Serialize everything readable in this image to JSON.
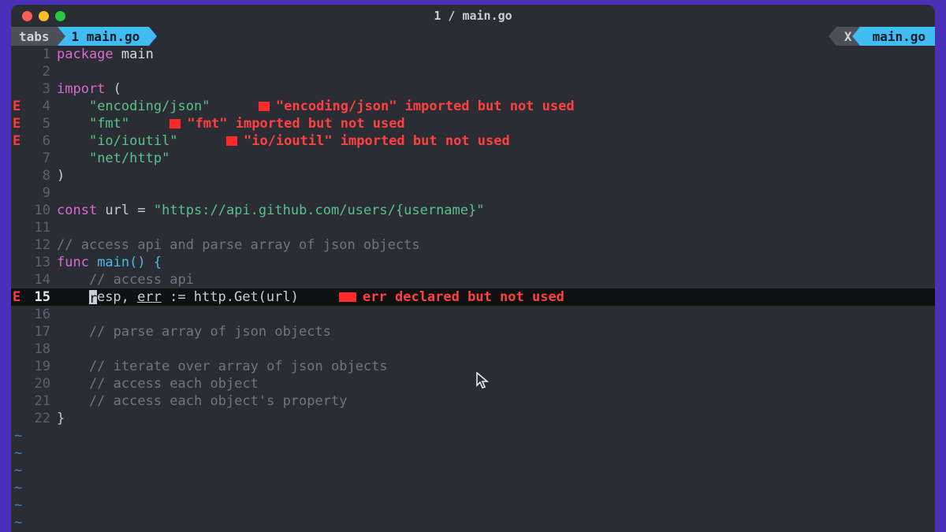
{
  "window": {
    "title": "1 / main.go"
  },
  "tabline": {
    "tabs_label": "tabs",
    "active_tab": "1 main.go",
    "close_x": "X",
    "right_name": "main.go"
  },
  "errors_gutter": {
    "E": "E"
  },
  "lines": {
    "n1": "1",
    "n2": "2",
    "n3": "3",
    "n4": "4",
    "n5": "5",
    "n6": "6",
    "n7": "7",
    "n8": "8",
    "n9": "9",
    "n10": "10",
    "n11": "11",
    "n12": "12",
    "n13": "13",
    "n14": "14",
    "n15": "15",
    "n16": "16",
    "n17": "17",
    "n18": "18",
    "n19": "19",
    "n20": "20",
    "n21": "21",
    "n22": "22"
  },
  "code": {
    "package": "package",
    "main": " main",
    "import": "import",
    "lparen": " (",
    "rparen": ")",
    "indent": "    ",
    "imp_json": "\"encoding/json\"",
    "imp_fmt": "\"fmt\"",
    "imp_ioutil": "\"io/ioutil\"",
    "imp_nethttp": "\"net/http\"",
    "const": "const",
    "url_decl": " url = ",
    "url_str": "\"https://api.github.com/users/{username}\"",
    "c_access_parse": "// access api and parse array of json objects",
    "func": "func",
    "main_sig": " main() {",
    "c_access_api": "    // access api",
    "resp_first": "r",
    "resp_rest": "esp, ",
    "err_word": "err",
    "assign": " := http.Get(url)",
    "c_parse": "    // parse array of json objects",
    "c_iterate": "    // iterate over array of json objects",
    "c_each_obj": "    // access each object",
    "c_each_prop": "    // access each object's property",
    "rbrace": "}",
    "sp_pre_l15": "    "
  },
  "diagnostics": {
    "json_pad": "      ",
    "json_msg": "\"encoding/json\" imported but not used",
    "fmt_pad": "     ",
    "fmt_msg": "\"fmt\" imported but not used",
    "ioutil_pad": "      ",
    "ioutil_msg": "\"io/ioutil\" imported but not used",
    "err_pad": "     ",
    "err_msg": "err declared but not used"
  },
  "tilde": "~"
}
